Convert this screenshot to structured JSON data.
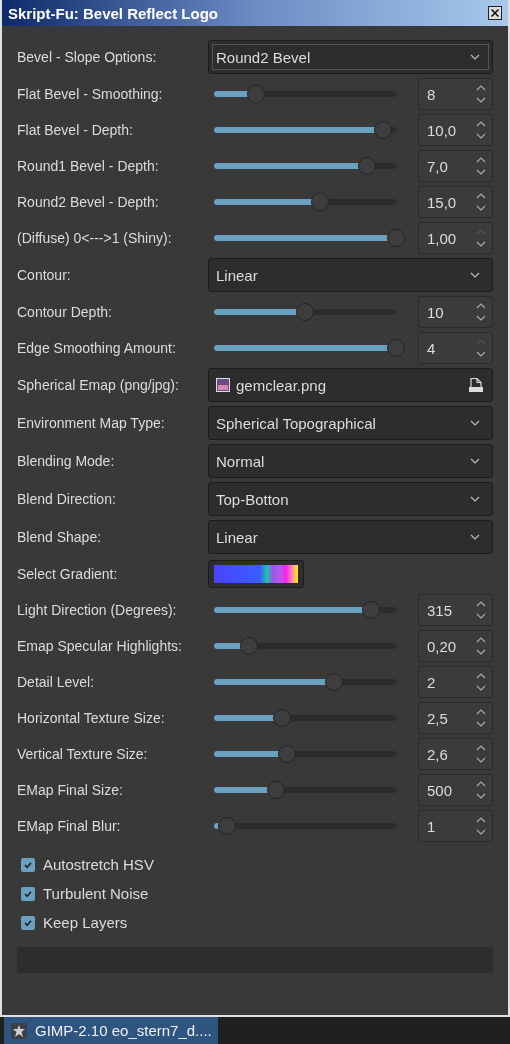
{
  "window": {
    "title": "Skript-Fu: Bevel Reflect Logo"
  },
  "rows": [
    {
      "kind": "combo",
      "label": "Bevel - Slope Options:",
      "value": "Round2 Bevel",
      "focused": true
    },
    {
      "kind": "slider",
      "label": "Flat Bevel - Smoothing:",
      "level": 0.23,
      "value": "8",
      "at_max": false
    },
    {
      "kind": "slider",
      "label": "Flat Bevel - Depth:",
      "level": 0.93,
      "value": "10,0",
      "at_max": false
    },
    {
      "kind": "slider",
      "label": "Round1 Bevel - Depth:",
      "level": 0.84,
      "value": "7,0",
      "at_max": false
    },
    {
      "kind": "slider",
      "label": "Round2 Bevel - Depth:",
      "level": 0.58,
      "value": "15,0",
      "at_max": false
    },
    {
      "kind": "slider",
      "label": "(Diffuse) 0<--->1 (Shiny):",
      "level": 1,
      "value": "1,00",
      "at_max": true
    },
    {
      "kind": "combo",
      "label": "Contour:",
      "value": "Linear",
      "focused": false
    },
    {
      "kind": "slider",
      "label": "Contour Depth:",
      "level": 0.5,
      "value": "10",
      "at_max": false
    },
    {
      "kind": "slider",
      "label": "Edge Smoothing Amount:",
      "level": 1,
      "value": "4",
      "at_max": true
    },
    {
      "kind": "file",
      "label": "Spherical Emap (png/jpg):",
      "value": "gemclear.png"
    },
    {
      "kind": "combo",
      "label": "Environment Map Type:",
      "value": "Spherical Topographical",
      "focused": false
    },
    {
      "kind": "combo",
      "label": "Blending Mode:",
      "value": "Normal",
      "focused": false
    },
    {
      "kind": "combo",
      "label": "Blend Direction:",
      "value": "Top-Botton",
      "focused": false
    },
    {
      "kind": "combo",
      "label": "Blend Shape:",
      "value": "Linear",
      "focused": false
    },
    {
      "kind": "gradient",
      "label": "Select Gradient:"
    },
    {
      "kind": "slider",
      "label": "Light Direction (Degrees):",
      "level": 0.86,
      "value": "315",
      "at_max": false
    },
    {
      "kind": "slider",
      "label": "Emap Specular Highlights:",
      "level": 0.19,
      "value": "0,20",
      "at_max": false
    },
    {
      "kind": "slider",
      "label": "Detail Level:",
      "level": 0.66,
      "value": "2",
      "at_max": false
    },
    {
      "kind": "slider",
      "label": "Horizontal Texture Size:",
      "level": 0.375,
      "value": "2,5",
      "at_max": false
    },
    {
      "kind": "slider",
      "label": "Vertical Texture Size:",
      "level": 0.4,
      "value": "2,6",
      "at_max": false
    },
    {
      "kind": "slider",
      "label": "EMap Final Size:",
      "level": 0.34,
      "value": "500",
      "at_max": false
    },
    {
      "kind": "slider",
      "label": "EMap Final Blur:",
      "level": 0.07,
      "value": "1",
      "at_max": false
    }
  ],
  "checkboxes": [
    {
      "label": "Autostretch HSV",
      "checked": true
    },
    {
      "label": "Turbulent Noise",
      "checked": true
    },
    {
      "label": "Keep Layers",
      "checked": true
    }
  ],
  "taskbar": {
    "item": "GIMP-2.10 eo_stern7_d...."
  }
}
